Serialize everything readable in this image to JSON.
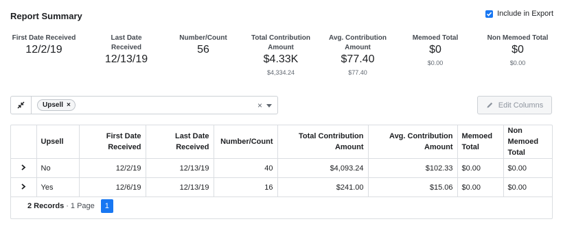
{
  "header": {
    "title": "Report Summary"
  },
  "export": {
    "label": "Include in Export",
    "checked": true
  },
  "stats": [
    {
      "label_lines": [
        "First Date Received"
      ],
      "value": "12/2/19",
      "sub": ""
    },
    {
      "label_lines": [
        "Last Date",
        "Received"
      ],
      "value": "12/13/19",
      "sub": ""
    },
    {
      "label_lines": [
        "Number/Count"
      ],
      "value": "56",
      "sub": ""
    },
    {
      "label_lines": [
        "Total Contribution",
        "Amount"
      ],
      "value": "$4.33K",
      "sub": "$4,334.24"
    },
    {
      "label_lines": [
        "Avg. Contribution",
        "Amount"
      ],
      "value": "$77.40",
      "sub": "$77.40"
    },
    {
      "label_lines": [
        "Memoed Total"
      ],
      "value": "$0",
      "sub": "$0.00"
    },
    {
      "label_lines": [
        "Non Memoed Total"
      ],
      "value": "$0",
      "sub": "$0.00"
    }
  ],
  "filter": {
    "chip_label": "Upsell",
    "chip_remove": "×",
    "clear": "×"
  },
  "edit_columns": {
    "label": "Edit Columns"
  },
  "table": {
    "columns": [
      {
        "lines": [
          "",
          ""
        ],
        "align": "center"
      },
      {
        "lines": [
          "Upsell",
          ""
        ],
        "align": "l"
      },
      {
        "lines": [
          "First Date",
          "Received"
        ],
        "align": "r"
      },
      {
        "lines": [
          "Last Date",
          "Received"
        ],
        "align": "r"
      },
      {
        "lines": [
          "Number/Count",
          ""
        ],
        "align": "r"
      },
      {
        "lines": [
          "Total Contribution",
          "Amount"
        ],
        "align": "r"
      },
      {
        "lines": [
          "Avg. Contribution",
          "Amount"
        ],
        "align": "r"
      },
      {
        "lines": [
          "Memoed",
          "Total"
        ],
        "align": "l"
      },
      {
        "lines": [
          "Non Memoed",
          "Total"
        ],
        "align": "l"
      }
    ],
    "rows": [
      [
        "No",
        "12/2/19",
        "12/13/19",
        "40",
        "$4,093.24",
        "$102.33",
        "$0.00",
        "$0.00"
      ],
      [
        "Yes",
        "12/6/19",
        "12/13/19",
        "16",
        "$241.00",
        "$15.06",
        "$0.00",
        "$0.00"
      ]
    ]
  },
  "footer": {
    "records": "2 Records",
    "pages": "· 1 Page",
    "current_page": "1"
  }
}
